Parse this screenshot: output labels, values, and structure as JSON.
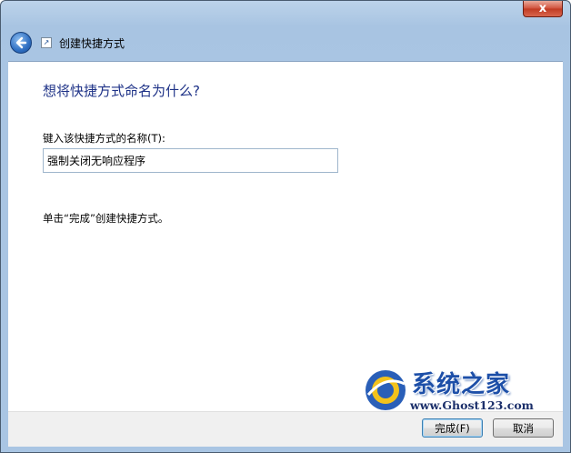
{
  "window": {
    "title": "创建快捷方式",
    "close_label": "x"
  },
  "icons": {
    "back": "back-arrow-icon",
    "app": "shortcut-icon",
    "close": "close-icon"
  },
  "main": {
    "heading": "想将快捷方式命名为什么?",
    "field_label": "键入该快捷方式的名称(T):",
    "field_value": "强制关闭无响应程序",
    "hint": "单击“完成”创建快捷方式。"
  },
  "watermark": {
    "title": "系统之家",
    "url": "www.Ghost123.com"
  },
  "footer": {
    "finish_label": "完成(F)",
    "cancel_label": "取消"
  },
  "colors": {
    "heading": "#1e3287",
    "frame": "#a9c5e3",
    "close": "#c03a22"
  }
}
